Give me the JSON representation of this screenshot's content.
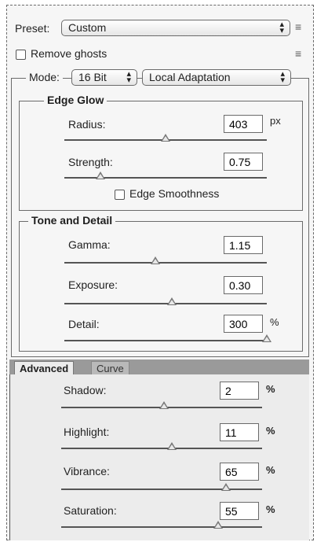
{
  "preset": {
    "label": "Preset:",
    "value": "Custom"
  },
  "remove_ghosts": {
    "label": "Remove ghosts",
    "checked": false
  },
  "mode": {
    "label": "Mode:",
    "bit_depth": "16 Bit",
    "method": "Local Adaptation"
  },
  "edge_glow": {
    "title": "Edge Glow",
    "radius": {
      "label": "Radius:",
      "value": "403",
      "unit": "px",
      "level": 0.5
    },
    "strength": {
      "label": "Strength:",
      "value": "0.75",
      "level": 0.18
    },
    "edge_smoothness": {
      "label": "Edge Smoothness",
      "checked": false
    }
  },
  "tone_and_detail": {
    "title": "Tone and Detail",
    "gamma": {
      "label": "Gamma:",
      "value": "1.15",
      "level": 0.45
    },
    "exposure": {
      "label": "Exposure:",
      "value": "0.30",
      "level": 0.53
    },
    "detail": {
      "label": "Detail:",
      "value": "300",
      "unit": "%",
      "level": 1.0
    }
  },
  "advanced": {
    "tabs": [
      "Advanced",
      "Curve"
    ],
    "active_tab": "Advanced",
    "shadow": {
      "label": "Shadow:",
      "value": "2",
      "unit": "%",
      "level": 0.51
    },
    "highlight": {
      "label": "Highlight:",
      "value": "11",
      "unit": "%",
      "level": 0.55
    },
    "vibrance": {
      "label": "Vibrance:",
      "value": "65",
      "unit": "%",
      "level": 0.82
    },
    "saturation": {
      "label": "Saturation:",
      "value": "55",
      "unit": "%",
      "level": 0.78
    }
  },
  "colors": {
    "panel_bg": "#f6f6f6",
    "advanced_bg": "#ececec",
    "tabbar_bg": "#9a9a9a",
    "border": "#6b6b6b"
  },
  "icons": {
    "select_arrows": "updown-chevron-icon",
    "panel_menu": "panel-menu-icon"
  }
}
